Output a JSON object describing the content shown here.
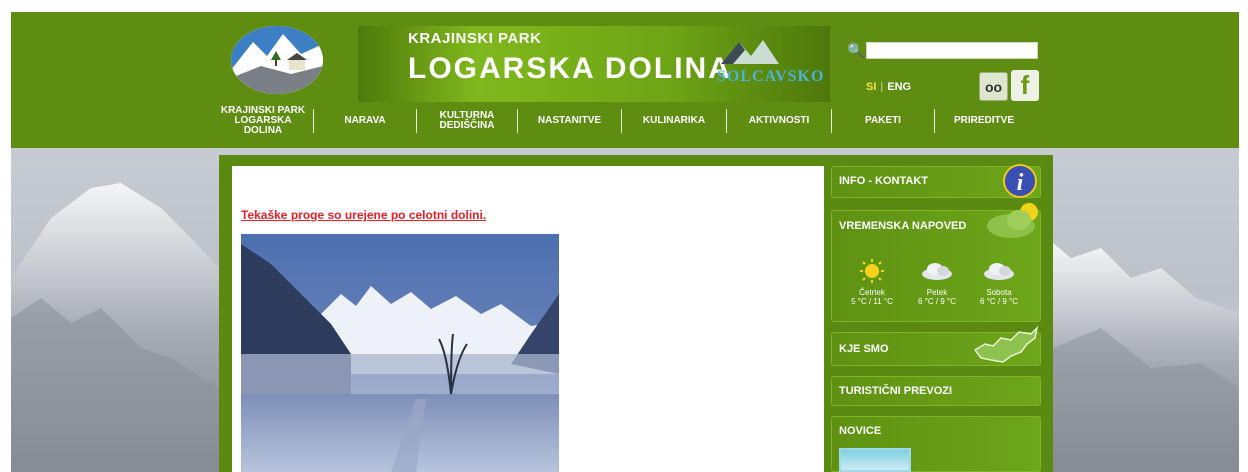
{
  "header": {
    "park_small": "KRAJINSKI PARK",
    "park_big": "LOGARSKA DOLINA",
    "partner_logo": "SOLCAVSKO",
    "search_placeholder": "",
    "lang_si": "SI",
    "lang_eng": "ENG"
  },
  "nav": {
    "items": [
      {
        "label": "KRAJINSKI PARK\nLOGARSKA\nDOLINA"
      },
      {
        "label": "NARAVA"
      },
      {
        "label": "KULTURNA\nDEDIŠČINA"
      },
      {
        "label": "NASTANITVE"
      },
      {
        "label": "KULINARIKA"
      },
      {
        "label": "AKTIVNOSTI"
      },
      {
        "label": "PAKETI"
      },
      {
        "label": "PRIREDITVE"
      }
    ]
  },
  "main": {
    "headline": "Tekaške proge so urejene po celotni dolini."
  },
  "sidebar": {
    "info": "INFO - KONTAKT",
    "weather_title": "VREMENSKA NAPOVED",
    "forecast": [
      {
        "day": "Četrtek",
        "temp": "5 °C / 11 °C",
        "icon": "sun-icon"
      },
      {
        "day": "Petek",
        "temp": "6 °C / 9 °C",
        "icon": "cloud-icon"
      },
      {
        "day": "Sobota",
        "temp": "6 °C / 9 °C",
        "icon": "cloud-icon"
      }
    ],
    "where": "KJE SMO",
    "transport": "TURISTIČNI PREVOZI",
    "news": "NOVICE"
  },
  "colors": {
    "header_green": "#5f8d12",
    "headline_red": "#e8202a",
    "lang_active": "#f3e33a"
  }
}
